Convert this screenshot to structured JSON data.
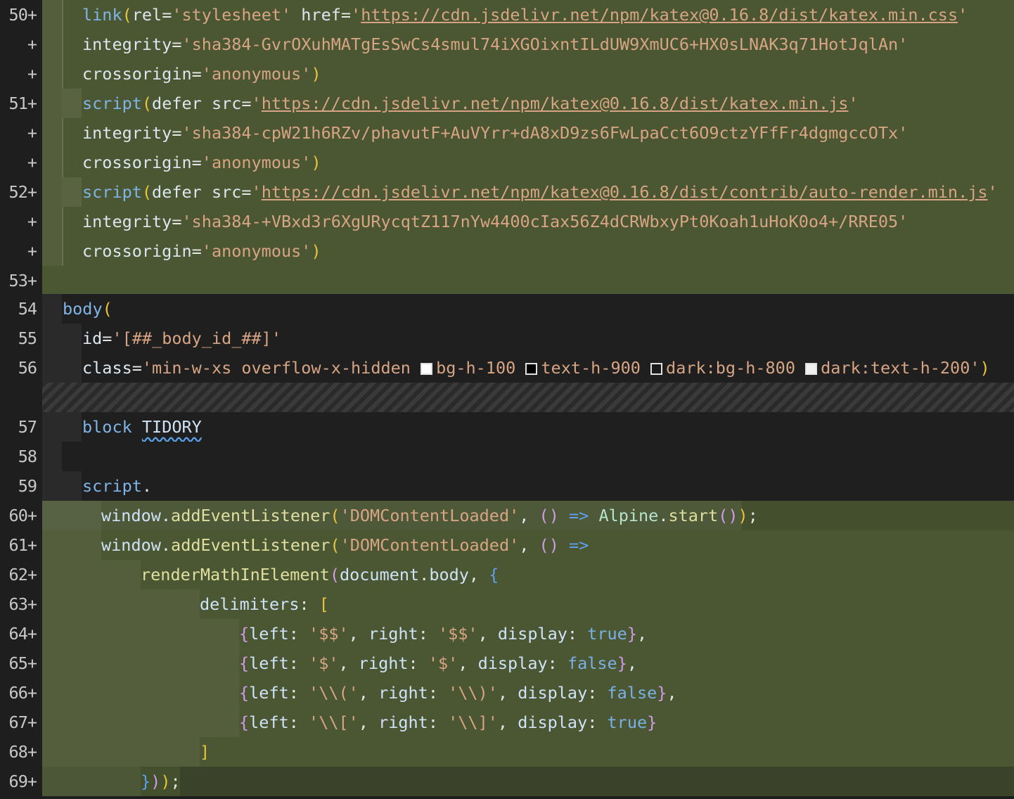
{
  "colors": {
    "added_bg": "#4b5632",
    "editor_bg": "#1e1e1e",
    "string": "#d7a583",
    "keyword": "#7fb4e6"
  },
  "lines": [
    {
      "gutter": "50+",
      "t": {
        "a": "link",
        "b": "(",
        "c": "rel",
        "d": "=",
        "e": "'stylesheet'",
        "f": " href",
        "g": "=",
        "h": "'",
        "i": "https://cdn.jsdelivr.net/npm/katex@0.16.8/dist/katex.min.css",
        "j": "'"
      }
    },
    {
      "gutter": "+",
      "t": {
        "a": "integrity",
        "b": "=",
        "c": "'sha384-GvrOXuhMATgEsSwCs4smul74iXGOixntILdUW9XmUC6+HX0sLNAK3q71HotJqlAn'"
      }
    },
    {
      "gutter": "+",
      "t": {
        "a": "crossorigin",
        "b": "=",
        "c": "'anonymous'",
        "d": ")"
      }
    },
    {
      "gutter": "51+",
      "t": {
        "a": "script",
        "b": "(",
        "c": "defer",
        "d": " src",
        "e": "=",
        "f": "'",
        "g": "https://cdn.jsdelivr.net/npm/katex@0.16.8/dist/katex.min.js",
        "h": "'"
      }
    },
    {
      "gutter": "+",
      "t": {
        "a": "integrity",
        "b": "=",
        "c": "'sha384-cpW21h6RZv/phavutF+AuVYrr+dA8xD9zs6FwLpaCct6O9ctzYFfFr4dgmgccOTx'"
      }
    },
    {
      "gutter": "+",
      "t": {
        "a": "crossorigin",
        "b": "=",
        "c": "'anonymous'",
        "d": ")"
      }
    },
    {
      "gutter": "52+",
      "t": {
        "a": "script",
        "b": "(",
        "c": "defer",
        "d": " src",
        "e": "=",
        "f": "'",
        "g": "https://cdn.jsdelivr.net/npm/katex@0.16.8/dist/contrib/auto-render.min.js",
        "h": "'"
      }
    },
    {
      "gutter": "+",
      "t": {
        "a": "integrity",
        "b": "=",
        "c": "'sha384-+VBxd3r6XgURycqtZ117nYw4400cIax56Z4dCRWbxyPt0Koah1uHoK0o4+/RRE05'"
      }
    },
    {
      "gutter": "+",
      "t": {
        "a": "crossorigin",
        "b": "=",
        "c": "'anonymous'",
        "d": ")"
      }
    },
    {
      "gutter": "53+",
      "t": {}
    },
    {
      "gutter": "54",
      "t": {
        "a": "body",
        "b": "("
      }
    },
    {
      "gutter": "55",
      "t": {
        "a": "id",
        "b": "=",
        "c": "'[##_body_id_##]'"
      }
    },
    {
      "gutter": "56",
      "t": {
        "a": "class",
        "b": "=",
        "c": "'min-w-xs overflow-x-hidden ",
        "d": "bg-h-100 ",
        "e": "text-h-900 ",
        "f": "dark:bg-h-800 ",
        "g": "dark:text-h-200",
        "h": "'",
        "i": ")"
      }
    },
    {
      "gutter": "57",
      "t": {
        "a": "block",
        "b": " ",
        "c": "TIDORY"
      }
    },
    {
      "gutter": "58",
      "t": {}
    },
    {
      "gutter": "59",
      "t": {
        "a": "script",
        "b": "."
      }
    },
    {
      "gutter": "60+",
      "t": {
        "a": "window",
        "b": ".",
        "c": "addEventListener",
        "d": "(",
        "e": "'DOMContentLoaded'",
        "f": ", ",
        "g": "()",
        "h": " => ",
        "i": "Alpine",
        "j": ".",
        "k": "start",
        "l": "()",
        "m": ")",
        "n": ";"
      }
    },
    {
      "gutter": "61+",
      "t": {
        "a": "window",
        "b": ".",
        "c": "addEventListener",
        "d": "(",
        "e": "'DOMContentLoaded'",
        "f": ", ",
        "g": "()",
        "h": " =>"
      }
    },
    {
      "gutter": "62+",
      "t": {
        "a": "renderMathInElement",
        "b": "(",
        "c": "document",
        "d": ".",
        "e": "body",
        "f": ", ",
        "g": "{"
      }
    },
    {
      "gutter": "63+",
      "t": {
        "a": "delimiters",
        "b": ": ",
        "c": "["
      }
    },
    {
      "gutter": "64+",
      "t": {
        "a": "{",
        "b": "left",
        "c": ": ",
        "d": "'$$'",
        "e": ", ",
        "f": "right",
        "g": ": ",
        "h": "'$$'",
        "i": ", ",
        "j": "display",
        "k": ": ",
        "l": "true",
        "m": "}",
        "n": ","
      }
    },
    {
      "gutter": "65+",
      "t": {
        "a": "{",
        "b": "left",
        "c": ": ",
        "d": "'$'",
        "e": ", ",
        "f": "right",
        "g": ": ",
        "h": "'$'",
        "i": ", ",
        "j": "display",
        "k": ": ",
        "l": "false",
        "m": "}",
        "n": ","
      }
    },
    {
      "gutter": "66+",
      "t": {
        "a": "{",
        "b": "left",
        "c": ": ",
        "d": "'\\\\('",
        "e": ", ",
        "f": "right",
        "g": ": ",
        "h": "'\\\\)'",
        "i": ", ",
        "j": "display",
        "k": ": ",
        "l": "false",
        "m": "}",
        "n": ","
      }
    },
    {
      "gutter": "67+",
      "t": {
        "a": "{",
        "b": "left",
        "c": ": ",
        "d": "'\\\\['",
        "e": ", ",
        "f": "right",
        "g": ": ",
        "h": "'\\\\]'",
        "i": ", ",
        "j": "display",
        "k": ": ",
        "l": "true",
        "m": "}"
      }
    },
    {
      "gutter": "68+",
      "t": {
        "a": "]"
      }
    },
    {
      "gutter": "69+",
      "t": {
        "a": "}",
        "b": ")",
        "c": ")",
        "d": ";"
      }
    }
  ]
}
